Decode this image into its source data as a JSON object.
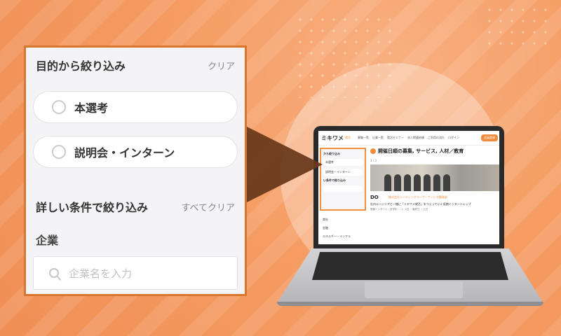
{
  "filter_panel": {
    "title": "目的から絞り込み",
    "clear": "クリア",
    "options": [
      "本選考",
      "説明会・インターン"
    ],
    "detail_title": "詳しい条件で絞り込み",
    "detail_clear": "すべてクリア",
    "company_label": "企業",
    "company_placeholder": "企業名を入力"
  },
  "mini_site": {
    "logo": "ミキワメ",
    "logo_tag": "就活",
    "nav": [
      "募集一覧",
      "企業一覧",
      "就活セミナー",
      "求人掲載依頼",
      "ご利用の流れ",
      "ログイン"
    ],
    "cta": "会員登録",
    "filter_header": "から絞り込み",
    "filter_options": [
      "本選考",
      "説明会・インターン"
    ],
    "filter_detail": "い条件で絞り込み",
    "side_items": [
      "商社",
      "金融",
      "エネルギー・インフラ"
    ],
    "page_title": "開催日順の募集, サービス, 人材／教育",
    "pagination": "1 / 3",
    "company_logo": "DO",
    "company_name": "株式会社シーディングマーケ・サービス開発部",
    "headline": "社内エンジニアと一緒に「ミキワメ就活」をつくっていく長期インターンシップ",
    "sub": "長期インターン・全学年 ・ 1・2日 ・最終日 ・土日"
  },
  "colors": {
    "accent": "#f08a3c",
    "background": "#f7a26a",
    "callout_border": "#d9772e"
  }
}
